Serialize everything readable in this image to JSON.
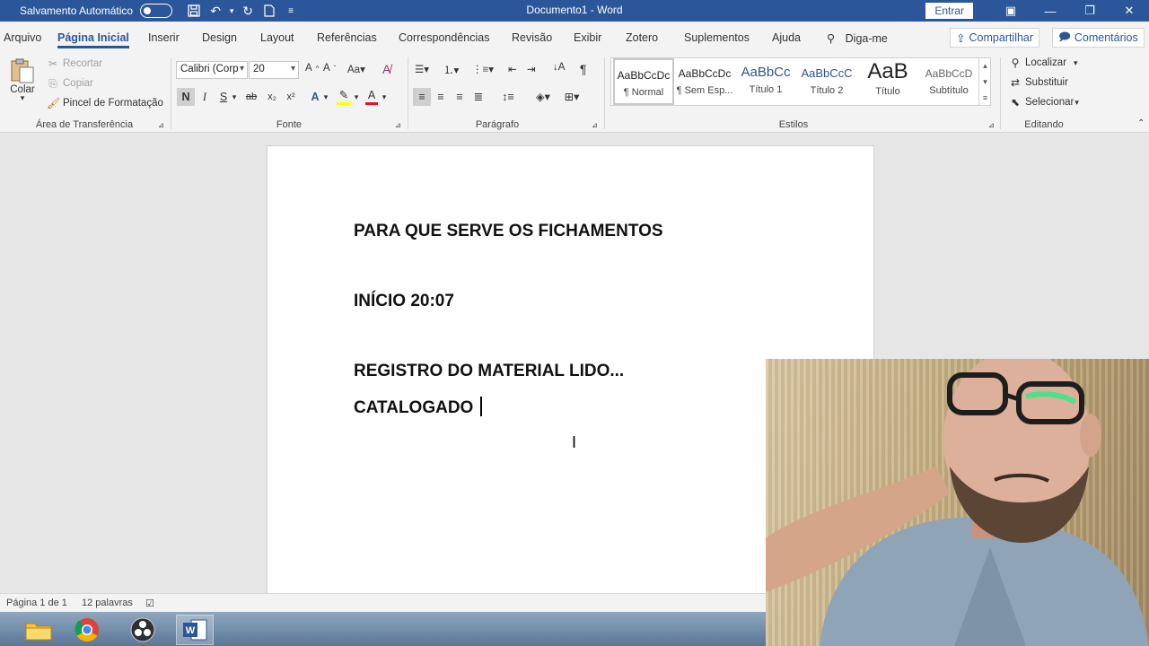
{
  "titlebar": {
    "autosave_label": "Salvamento Automático",
    "title": "Documento1 - Word",
    "signin_label": "Entrar"
  },
  "tabs": [
    {
      "label": "Arquivo"
    },
    {
      "label": "Página Inicial"
    },
    {
      "label": "Inserir"
    },
    {
      "label": "Design"
    },
    {
      "label": "Layout"
    },
    {
      "label": "Referências"
    },
    {
      "label": "Correspondências"
    },
    {
      "label": "Revisão"
    },
    {
      "label": "Exibir"
    },
    {
      "label": "Zotero"
    },
    {
      "label": "Suplementos"
    },
    {
      "label": "Ajuda"
    },
    {
      "label": "Diga-me"
    }
  ],
  "share_label": "Compartilhar",
  "comments_label": "Comentários",
  "clipboard": {
    "paste_label": "Colar",
    "cut_label": "Recortar",
    "copy_label": "Copiar",
    "format_painter_label": "Pincel de Formatação",
    "group_label": "Área de Transferência"
  },
  "font": {
    "family": "Calibri (Corp",
    "size": "20",
    "bold": "N",
    "italic": "I",
    "underline": "S",
    "strike": "ab",
    "group_label": "Fonte"
  },
  "paragraph": {
    "group_label": "Parágrafo"
  },
  "styles": {
    "items": [
      {
        "sample": "AaBbCcDc",
        "name": "¶ Normal"
      },
      {
        "sample": "AaBbCcDc",
        "name": "¶ Sem Esp..."
      },
      {
        "sample": "AaBbCc",
        "name": "Título 1"
      },
      {
        "sample": "AaBbCcC",
        "name": "Título 2"
      },
      {
        "sample": "AaB",
        "name": "Título"
      },
      {
        "sample": "AaBbCcD",
        "name": "Subtítulo"
      }
    ],
    "group_label": "Estilos"
  },
  "editing": {
    "find_label": "Localizar",
    "replace_label": "Substituir",
    "select_label": "Selecionar",
    "group_label": "Editando"
  },
  "document": {
    "lines": [
      "PARA QUE SERVE OS FICHAMENTOS",
      "INÍCIO 20:07",
      "REGISTRO DO MATERIAL LIDO...",
      "CATALOGADO "
    ]
  },
  "status": {
    "page": "Página 1 de 1",
    "words": "12 palavras"
  },
  "colors": {
    "word_blue": "#2b579a",
    "highlight": "#ffff00",
    "font_color": "#e81123"
  }
}
